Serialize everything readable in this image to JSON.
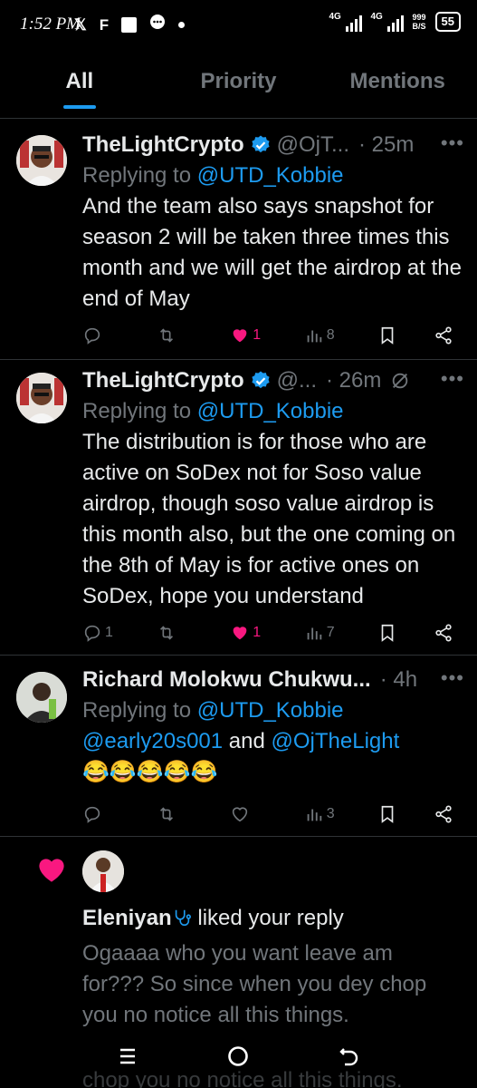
{
  "status_bar": {
    "time": "1:52 PM",
    "net1": "4G",
    "net2": "4G",
    "speed": "999",
    "speed_unit": "B/S",
    "battery": "55",
    "icons": [
      "x-logo-icon",
      "f-app-icon",
      "square-icon",
      "chat-bubble-icon",
      "dot-icon"
    ]
  },
  "tabs": [
    {
      "label": "All",
      "active": true
    },
    {
      "label": "Priority",
      "active": false
    },
    {
      "label": "Mentions",
      "active": false
    }
  ],
  "tweets": [
    {
      "name": "TheLightCrypto",
      "handle": "@OjT...",
      "time": "· 25m",
      "replying_prefix": "Replying to ",
      "replying_to": "@UTD_Kobbie",
      "text": "And the team also says snapshot for season 2 will be taken three times this month and we will get the airdrop at the end of May",
      "replies": "",
      "likes": "1",
      "views": "8",
      "liked": true
    },
    {
      "name": "TheLightCrypto",
      "handle": "@...",
      "time": "· 26m",
      "replying_prefix": "Replying to ",
      "replying_to": "@UTD_Kobbie",
      "text": "The distribution is for those who are active on SoDex not for Soso value airdrop, though soso value airdrop is this month also, but the one coming on the 8th of May is for active ones on SoDex, hope you understand",
      "replies": "1",
      "likes": "1",
      "views": "7",
      "liked": true
    },
    {
      "name": "Richard Molokwu Chukwu...",
      "handle": "",
      "time": "· 4h",
      "replying_prefix": "Replying to ",
      "replying_to": "@UTD_Kobbie",
      "mention1": "@early20s001",
      "and": " and ",
      "mention2": "@OjTheLight",
      "emoji": "😂😂😂😂😂",
      "replies": "",
      "likes": "",
      "views": "3",
      "liked": false
    }
  ],
  "notification": {
    "name": "Eleniyan",
    "name_icon": "stethoscope-icon",
    "action": " liked your reply",
    "text": "Ogaaaa who you want leave am for???  So since when you dey chop you no notice all this things.",
    "ghost_text": "chop you no notice all this things."
  },
  "colors": {
    "accent": "#1d9bf0",
    "like": "#f91880",
    "muted": "#71767b",
    "text": "#e7e9ea",
    "bg": "#000000"
  }
}
